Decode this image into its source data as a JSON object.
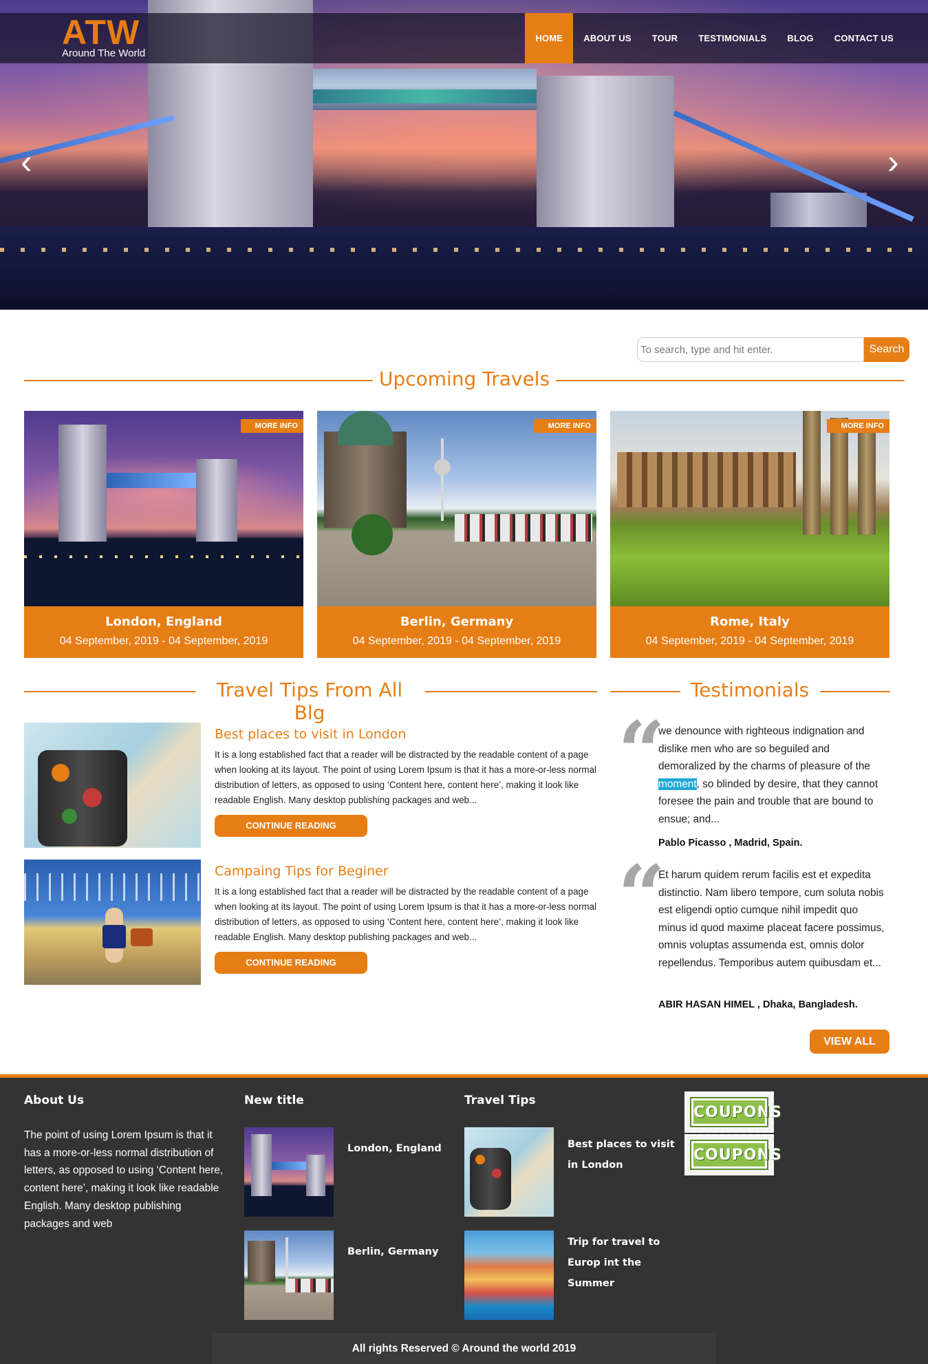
{
  "brand": {
    "logo": "ATW",
    "tagline": "Around The World"
  },
  "nav": {
    "items": [
      "HOME",
      "ABOUT US",
      "TOUR",
      "TESTIMONIALS",
      "BLOG",
      "CONTACT US"
    ],
    "active": "HOME"
  },
  "slider": {
    "prev": "‹",
    "next": "›"
  },
  "search": {
    "placeholder": "To search, type and hit enter.",
    "button": "Search"
  },
  "upcoming": {
    "title": "Upcoming Travels",
    "tag": "MORE INFO",
    "cards": [
      {
        "name": "London, England",
        "dates": "04 September, 2019 - 04 September, 2019"
      },
      {
        "name": "Berlin, Germany",
        "dates": "04 September, 2019 - 04 September, 2019"
      },
      {
        "name": "Rome, Italy",
        "dates": "04 September, 2019 - 04 September, 2019"
      }
    ]
  },
  "tips": {
    "title": "Travel Tips From All Blg",
    "button": "CONTINUE READING",
    "items": [
      {
        "title": "Best places to visit in London",
        "body": "It is a long established fact that a reader will be distracted by the readable content of a page when looking at its layout. The point of using Lorem Ipsum is that it has a more-or-less normal distribution of letters, as opposed to using ‘Content here, content here’, making it look like readable English. Many desktop publishing packages and web..."
      },
      {
        "title": "Campaing Tips for Beginer",
        "body": "It is a long established fact that a reader will be distracted by the readable content of a page when looking at its layout. The point of using Lorem Ipsum is that it has a more-or-less normal distribution of letters, as opposed to using ‘Content here, content here’, making it look like readable English. Many desktop publishing packages and web..."
      }
    ]
  },
  "testimonials": {
    "title": "Testimonials",
    "items": [
      {
        "text_before": "we denounce with righteous indignation and dislike men who are so beguiled and demoralized by the charms of pleasure of the ",
        "highlight": "moment",
        "text_after": ", so blinded by desire, that they cannot foresee the pain and trouble that are bound to ensue; and...",
        "author": "Pablo Picasso , Madrid, Spain."
      },
      {
        "text": "Et harum quidem rerum facilis est et expedita distinctio. Nam libero tempore, cum soluta nobis est eligendi optio cumque nihil impedit quo minus id quod maxime placeat facere possimus, omnis voluptas assumenda est, omnis dolor repellendus. Temporibus autem quibusdam et...",
        "author": "ABIR HASAN HIMEL , Dhaka, Bangladesh."
      }
    ],
    "view_all": "VIEW ALL"
  },
  "footer": {
    "about_title": "About Us",
    "about_text": "The point of using Lorem Ipsum is that it has a more-or-less normal distribution of letters, as opposed to using ‘Content here, content here’, making it look like readable English. Many desktop publishing packages and web",
    "new_title": "New title",
    "new_items": [
      "London, England",
      "Berlin, Germany"
    ],
    "tips_title": "Travel Tips",
    "tips_items": [
      "Best places to visit in London",
      "Trip for travel to Europ int the Summer"
    ],
    "coupons": [
      "COUPONS",
      "COUPONS"
    ],
    "copyright": "All rights Reserved © Around the world 2019"
  },
  "colors": {
    "accent": "#e67e16",
    "footer_bg": "#333333"
  }
}
